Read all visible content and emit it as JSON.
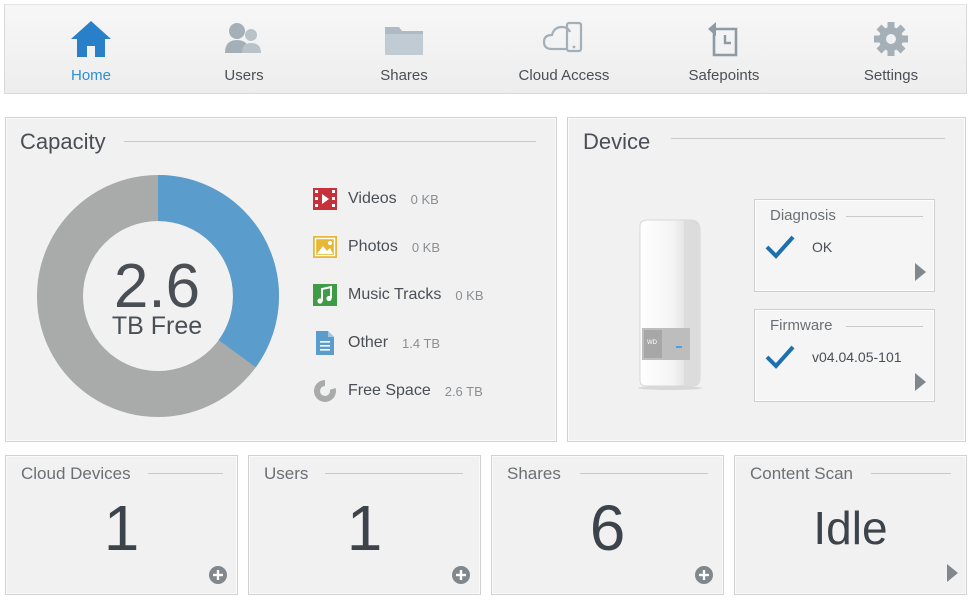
{
  "nav": {
    "items": [
      {
        "label": "Home",
        "icon": "home-icon",
        "active": true
      },
      {
        "label": "Users",
        "icon": "users-icon",
        "active": false
      },
      {
        "label": "Shares",
        "icon": "folder-icon",
        "active": false
      },
      {
        "label": "Cloud Access",
        "icon": "cloud-device-icon",
        "active": false
      },
      {
        "label": "Safepoints",
        "icon": "safepoint-icon",
        "active": false
      },
      {
        "label": "Settings",
        "icon": "gear-icon",
        "active": false
      }
    ]
  },
  "capacity": {
    "title": "Capacity",
    "free_value": "2.6",
    "free_label": "TB Free",
    "used_fraction": 0.35,
    "legend": [
      {
        "name": "Videos",
        "value": "0 KB",
        "icon": "video-icon"
      },
      {
        "name": "Photos",
        "value": "0 KB",
        "icon": "photo-icon"
      },
      {
        "name": "Music Tracks",
        "value": "0 KB",
        "icon": "music-icon"
      },
      {
        "name": "Other",
        "value": "1.4 TB",
        "icon": "document-icon"
      },
      {
        "name": "Free Space",
        "value": "2.6 TB",
        "icon": "pie-icon"
      }
    ],
    "colors": {
      "used": "#5a9ccb",
      "free": "#a8abaa"
    }
  },
  "device": {
    "title": "Device",
    "diagnosis": {
      "title": "Diagnosis",
      "status": "OK"
    },
    "firmware": {
      "title": "Firmware",
      "version": "v04.04.05-101"
    }
  },
  "tiles": [
    {
      "title": "Cloud Devices",
      "value": "1",
      "action": "add"
    },
    {
      "title": "Users",
      "value": "1",
      "action": "add"
    },
    {
      "title": "Shares",
      "value": "6",
      "action": "add"
    },
    {
      "title": "Content Scan",
      "value": "Idle",
      "action": "details"
    }
  ],
  "colors": {
    "accent": "#2f8fd0",
    "check": "#1e6fae"
  }
}
